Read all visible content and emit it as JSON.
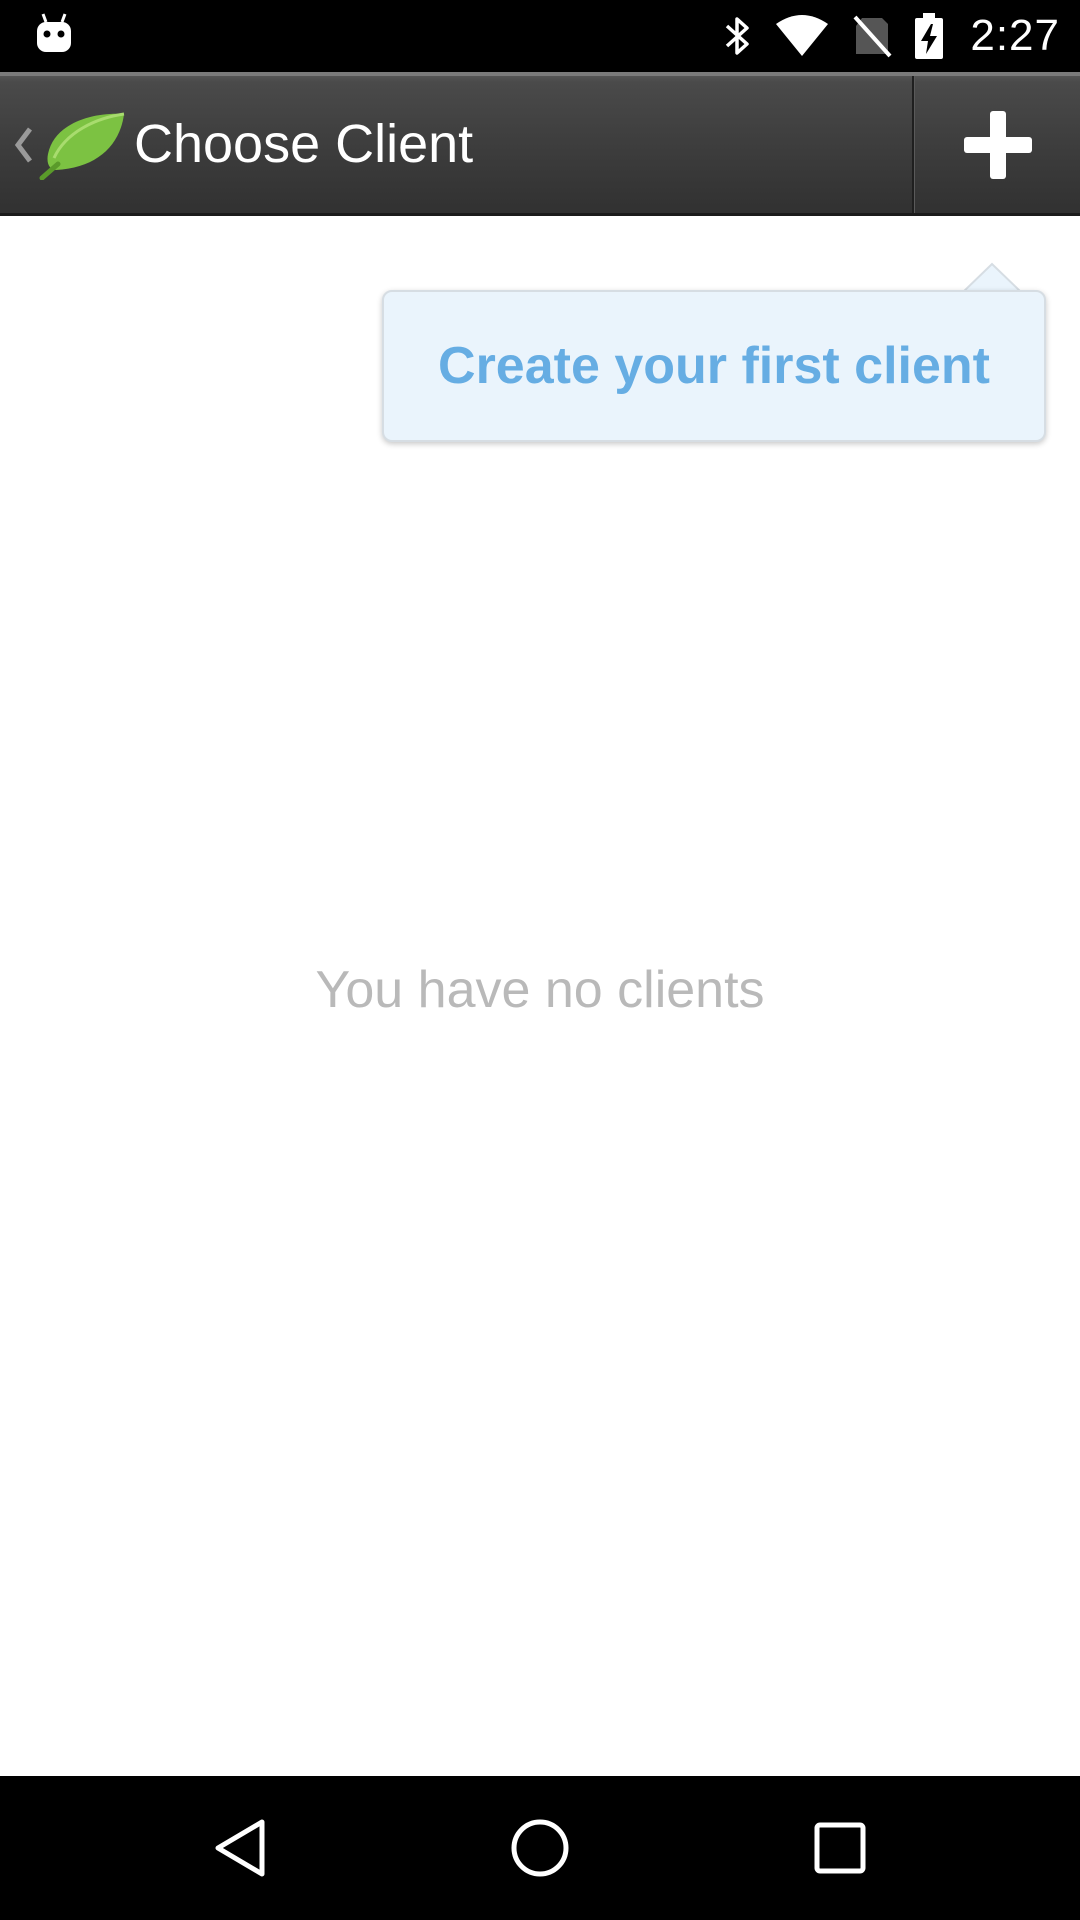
{
  "status_bar": {
    "time": "2:27",
    "icons": [
      "android-notification-icon",
      "bluetooth-icon",
      "wifi-icon",
      "no-sim-icon",
      "battery-charging-icon"
    ]
  },
  "action_bar": {
    "title": "Choose Client",
    "back_icon": "chevron-left-icon",
    "app_icon": "leaf-icon",
    "add_icon": "plus-icon"
  },
  "tooltip": {
    "text": "Create your first client"
  },
  "empty_state": {
    "text": "You have no clients"
  },
  "nav_bar": {
    "buttons": [
      "back-triangle-icon",
      "home-circle-icon",
      "recents-square-icon"
    ]
  },
  "colors": {
    "status_bar_bg": "#000000",
    "action_bar_bg": "#3f3f3f",
    "tooltip_bg": "#eaf4fc",
    "tooltip_text": "#66ade3",
    "empty_text": "#b9b9b9",
    "leaf_green": "#7cc242"
  }
}
